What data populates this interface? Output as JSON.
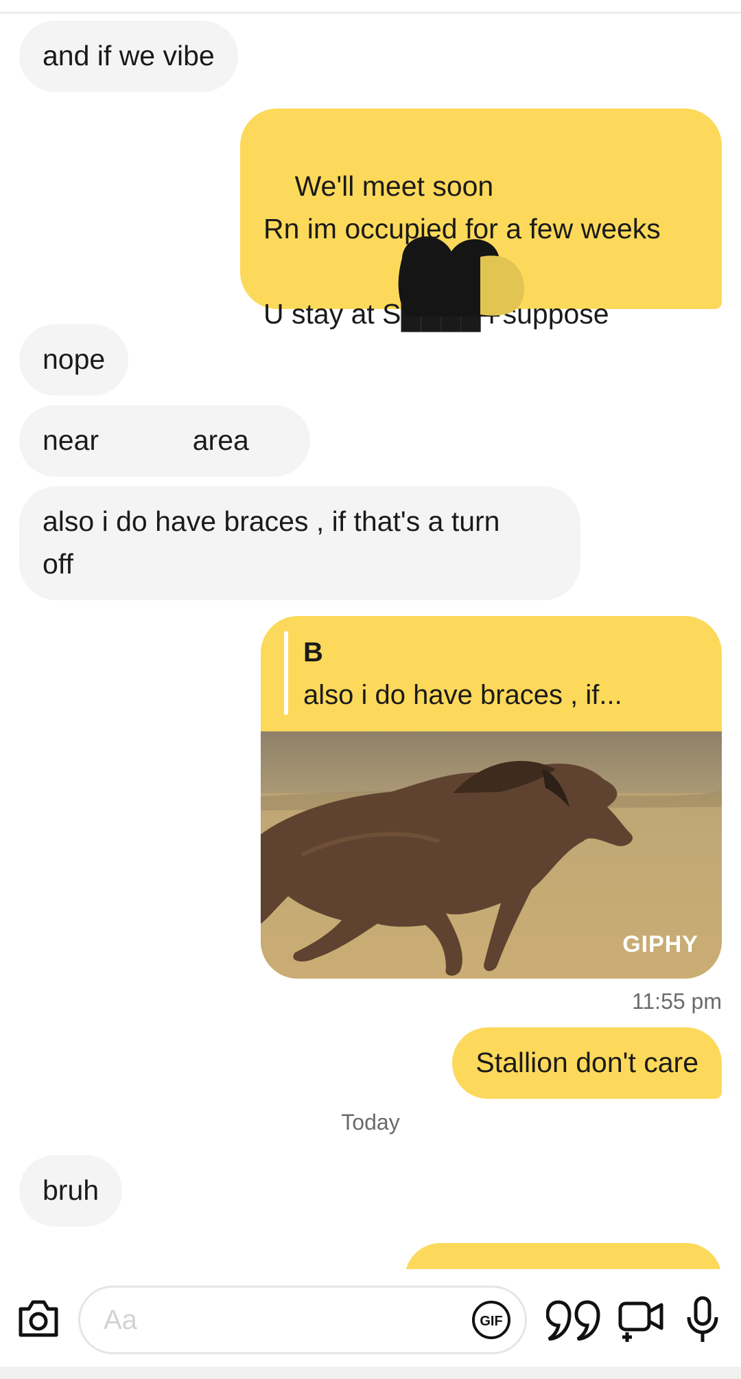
{
  "messages": {
    "m1": "and if we vibe",
    "m2": "We'll meet soon\nRn im occupied for a few weeks\n\nU stay at S████ i suppose",
    "m3": "nope",
    "m4": "near            area",
    "m5": "also i do have braces , if that's a turn\noff",
    "quote_author": "B",
    "quote_text": "also i do have braces , if...",
    "gif_brand": "GIPHY",
    "m6": "Stallion don't care",
    "time": "11:55 pm",
    "day_divider": "Today",
    "m7": "bruh"
  },
  "composer": {
    "placeholder": "Aa",
    "gif_label": "GIF"
  },
  "colors": {
    "outgoing": "#fcd95a",
    "incoming": "#f4f4f4"
  }
}
